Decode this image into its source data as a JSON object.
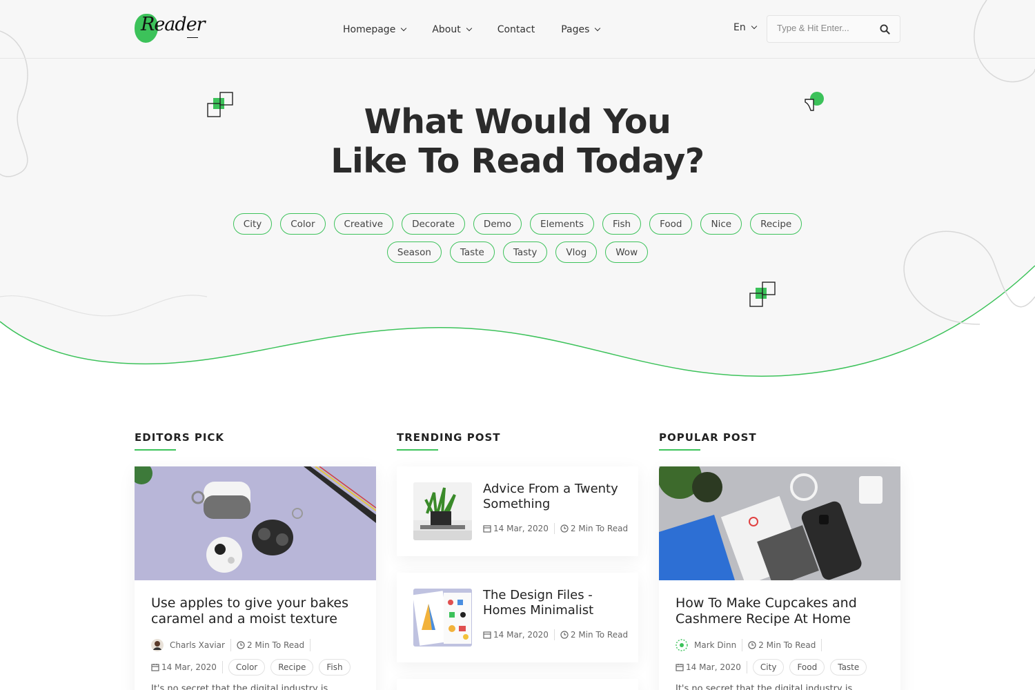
{
  "header": {
    "logo_text": "Reader",
    "nav": [
      {
        "label": "Homepage",
        "has_dropdown": true
      },
      {
        "label": "About",
        "has_dropdown": true
      },
      {
        "label": "Contact",
        "has_dropdown": false
      },
      {
        "label": "Pages",
        "has_dropdown": true
      }
    ],
    "language": "En",
    "search_placeholder": "Type & Hit Enter..."
  },
  "hero": {
    "title_line1": "What Would You",
    "title_line2": "Like To Read Today?",
    "tags_row1": [
      "City",
      "Color",
      "Creative",
      "Decorate",
      "Demo",
      "Elements",
      "Fish",
      "Food",
      "Nice",
      "Recipe"
    ],
    "tags_row2": [
      "Season",
      "Taste",
      "Tasty",
      "Vlog",
      "Wow"
    ]
  },
  "sections": {
    "editors_pick": {
      "title": "EDITORS PICK",
      "post": {
        "title": "Use apples to give your bakes caramel and a moist texture",
        "author": "Charls Xaviar",
        "read_time": "2 Min To Read",
        "date": "14 Mar, 2020",
        "tags": [
          "Color",
          "Recipe",
          "Fish"
        ],
        "excerpt": "It's no secret that the digital industry is"
      }
    },
    "trending": {
      "title": "TRENDING POST",
      "posts": [
        {
          "title": "Advice From a Twenty Something",
          "date": "14 Mar, 2020",
          "read_time": "2 Min To Read"
        },
        {
          "title": "The Design Files - Homes Minimalist",
          "date": "14 Mar, 2020",
          "read_time": "2 Min To Read"
        }
      ]
    },
    "popular": {
      "title": "POPULAR POST",
      "post": {
        "title": "How To Make Cupcakes and Cashmere Recipe At Home",
        "author": "Mark Dinn",
        "read_time": "2 Min To Read",
        "date": "14 Mar, 2020",
        "tags": [
          "City",
          "Food",
          "Taste"
        ],
        "excerpt": "It's no secret that the digital industry is"
      }
    }
  },
  "colors": {
    "accent": "#3cc25a",
    "hero_bg": "#f7f7f7",
    "text": "#222222"
  }
}
